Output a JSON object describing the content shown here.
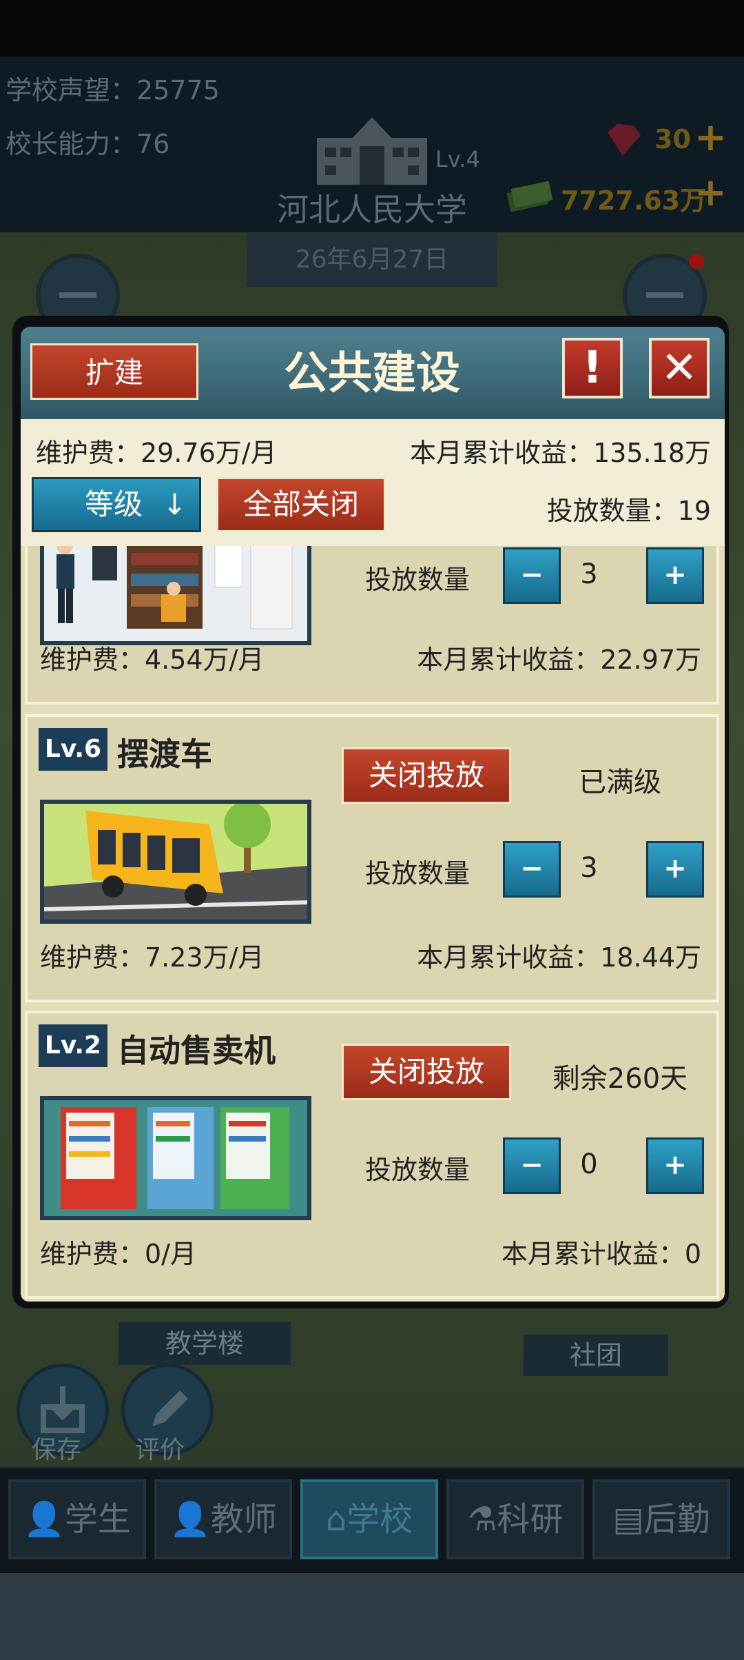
{
  "header": {
    "reputation_label": "学校声望：",
    "reputation_value": "25775",
    "ability_label": "校长能力：",
    "ability_value": "76",
    "school_level": "Lv.4",
    "school_name": "河北人民大学",
    "gems": "30",
    "money": "7727.63万",
    "date": "26年6月27日"
  },
  "dialog": {
    "title": "公共建设",
    "expand_label": "扩建",
    "alert_label": "!",
    "close_label": "✕",
    "maintenance_total": "维护费：29.76万/月",
    "income_total": "本月累计收益：135.18万",
    "level_sort_label": "等级",
    "level_sort_arrow": "↓",
    "close_all_label": "全部关闭",
    "deploy_total": "投放数量：19"
  },
  "cards": [
    {
      "qty_label": "投放数量",
      "qty": "3",
      "maintenance": "维护费：4.54万/月",
      "income": "本月累计收益：22.97万"
    },
    {
      "level": "Lv.6",
      "name": "摆渡车",
      "close_label": "关闭投放",
      "status": "已满级",
      "qty_label": "投放数量",
      "qty": "3",
      "maintenance": "维护费：7.23万/月",
      "income": "本月累计收益：18.44万"
    },
    {
      "level": "Lv.2",
      "name": "自动售卖机",
      "close_label": "关闭投放",
      "status": "剩余260天",
      "qty_label": "投放数量",
      "qty": "0",
      "maintenance": "维护费：0/月",
      "income": "本月累计收益：0"
    }
  ],
  "qty_minus": "−",
  "qty_plus": "+",
  "map": {
    "teaching_building": "教学楼",
    "club": "社团",
    "save_label": "保存",
    "review_label": "评价"
  },
  "nav": [
    "学生",
    "教师",
    "学校",
    "科研",
    "后勤"
  ],
  "nav_active": "学校",
  "colors": {
    "accent_red": "#b43a22",
    "accent_blue": "#1f85ab",
    "panel_bg": "#f1edd6"
  }
}
